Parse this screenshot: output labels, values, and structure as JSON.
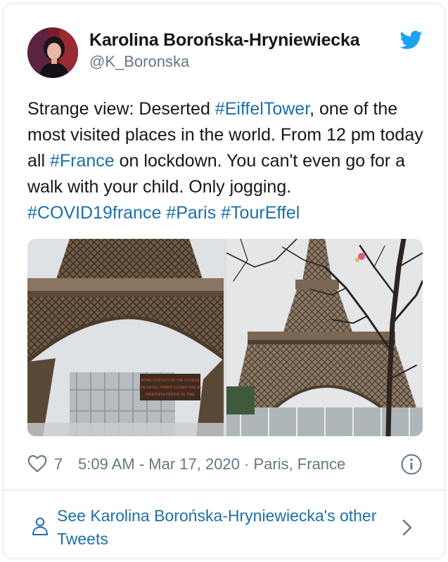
{
  "author": {
    "name": "Karolina Borońska-Hryniewiecka",
    "handle": "@K_Boronska"
  },
  "tweet": {
    "segments": [
      {
        "text": "Strange view: Deserted ",
        "tag": false
      },
      {
        "text": "#EiffelTower",
        "tag": true
      },
      {
        "text": ",  one of the most visited places in the world. From 12 pm today all ",
        "tag": false
      },
      {
        "text": "#France",
        "tag": true
      },
      {
        "text": " on lockdown. You can't even go for a walk with your child.  Only jogging. ",
        "tag": false
      },
      {
        "text": "#COVID19france",
        "tag": true
      },
      {
        "text": " ",
        "tag": false
      },
      {
        "text": "#Paris",
        "tag": true
      },
      {
        "text": " ",
        "tag": false
      },
      {
        "text": "#TourEffel",
        "tag": true
      }
    ],
    "photo_sign": [
      "INTHE CONTEXT OF THE COVID19",
      "THE EIFFEL TOWER CLOSED FOR AN",
      "INDEFINITE PERIOD OF TIME"
    ]
  },
  "meta": {
    "likes": "7",
    "timestamp": "5:09 AM - Mar 17, 2020 · Paris, France"
  },
  "footer": {
    "see_more": "See Karolina Borońska-Hryniewiecka's other Tweets"
  },
  "icons": {
    "heart": "heart-icon",
    "info": "info-icon",
    "bird": "twitter-bird-icon",
    "person": "person-icon",
    "chevron": "chevron-right-icon"
  },
  "colors": {
    "link": "#1b6fa8",
    "twitter_blue": "#1da1f2",
    "muted": "#657786",
    "border": "#dfe4e8"
  }
}
